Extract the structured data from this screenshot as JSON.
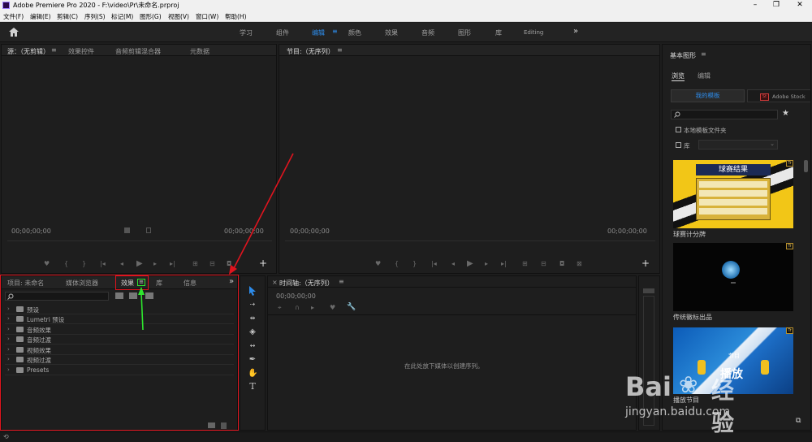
{
  "app": {
    "title": "Adobe Premiere Pro 2020 - F:\\video\\Pr\\未命名.prproj"
  },
  "window_controls": {
    "minimize": "–",
    "maximize": "❐",
    "close": "✕"
  },
  "menu": [
    "文件(F)",
    "编辑(E)",
    "剪辑(C)",
    "序列(S)",
    "标记(M)",
    "图形(G)",
    "视图(V)",
    "窗口(W)",
    "帮助(H)"
  ],
  "workspaces": [
    "学习",
    "组件",
    "编辑",
    "颜色",
    "效果",
    "音频",
    "图形",
    "库",
    "Editing"
  ],
  "workspace_more": "»",
  "source_panel": {
    "tabs": [
      "源：（无剪辑）",
      "效果控件",
      "音频剪辑混合器",
      "元数据"
    ],
    "timecode_left": "00;00;00;00",
    "timecode_right": "00;00;00;00"
  },
  "program_panel": {
    "tab": "节目:（无序列）",
    "timecode_left": "00;00;00;00",
    "timecode_right": "00;00;00;00"
  },
  "project_panel": {
    "tabs": [
      "项目: 未命名",
      "媒体浏览器",
      "效果",
      "库",
      "信息"
    ],
    "more": "»",
    "folders": [
      "预设",
      "Lumetri 预设",
      "音频效果",
      "音频过渡",
      "视频效果",
      "视频过渡",
      "Presets"
    ]
  },
  "timeline_panel": {
    "close": "×",
    "tab": "时间轴:（无序列）",
    "timecode": "00;00;00;00",
    "drop_hint": "在此处放下媒体以创建序列。"
  },
  "essential_graphics": {
    "title": "基本图形",
    "tabs": [
      "浏览",
      "编辑"
    ],
    "my_templates": "我的模板",
    "adobe_stock": "Adobe Stock",
    "stock_badge": "St",
    "local_folder": "本地模板文件夹",
    "library": "库",
    "templates": [
      {
        "name": "球赛计分牌",
        "banner": "球赛结果"
      },
      {
        "name": "传统徽标出品"
      },
      {
        "name": "播放节目",
        "banner": "播放",
        "sub": "节目"
      }
    ]
  },
  "watermark": {
    "brand": "Bai",
    "brand2": "经验",
    "url": "jingyan.baidu.com"
  },
  "colors": {
    "accent": "#2d8ceb",
    "highlight_red": "#e0141e",
    "arrow_green": "#2ee62e"
  }
}
